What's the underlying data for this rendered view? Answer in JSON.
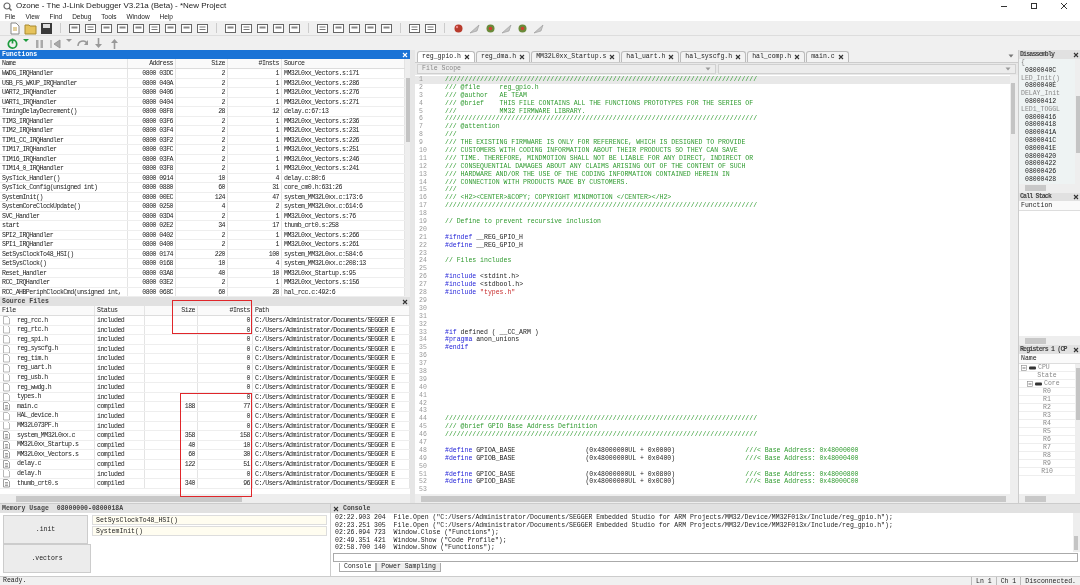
{
  "window": {
    "title": "Ozone - The J-Link Debugger V3.21a (Beta) - *New Project"
  },
  "menu": [
    "File",
    "View",
    "Find",
    "Debug",
    "Tools",
    "Window",
    "Help"
  ],
  "functions": {
    "title": "Functions",
    "columns": [
      "Name",
      "Address",
      "Size",
      "#Insts",
      "Source"
    ],
    "rows": [
      [
        "WWDG_IRQHandler",
        "0800 03DC",
        "2",
        "1",
        "MM32L0xx_Vectors.s:171"
      ],
      [
        "USB_FS_WKUP_IRQHandler",
        "0800 040A",
        "2",
        "1",
        "MM32L0xx_Vectors.s:286"
      ],
      [
        "UART2_IRQHandler",
        "0800 0406",
        "2",
        "1",
        "MM32L0xx_Vectors.s:276"
      ],
      [
        "UART1_IRQHandler",
        "0800 0404",
        "2",
        "1",
        "MM32L0xx_Vectors.s:271"
      ],
      [
        "TimingDelayDecrement()",
        "0800 08F8",
        "28",
        "12",
        "delay.c:67:13"
      ],
      [
        "TIM3_IRQHandler",
        "0800 03F6",
        "2",
        "1",
        "MM32L0xx_Vectors.s:236"
      ],
      [
        "TIM2_IRQHandler",
        "0800 03F4",
        "2",
        "1",
        "MM32L0xx_Vectors.s:231"
      ],
      [
        "TIM1_CC_IRQHandler",
        "0800 03F2",
        "2",
        "1",
        "MM32L0xx_Vectors.s:226"
      ],
      [
        "TIM17_IRQHandler",
        "0800 03FC",
        "2",
        "1",
        "MM32L0xx_Vectors.s:251"
      ],
      [
        "TIM16_IRQHandler",
        "0800 03FA",
        "2",
        "1",
        "MM32L0xx_Vectors.s:246"
      ],
      [
        "TIM14_0_IRQHandler",
        "0800 03F8",
        "2",
        "1",
        "MM32L0xx_Vectors.s:241"
      ],
      [
        "SysTick_Handler()",
        "0800 0914",
        "10",
        "4",
        "delay.c:80:6"
      ],
      [
        "SysTick_Config(unsigned int)",
        "0800 0880",
        "60",
        "31",
        "core_cm0.h:631:26"
      ],
      [
        "SystemInit()",
        "0800 00EC",
        "124",
        "47",
        "system_MM32L0xx.c:173:6"
      ],
      [
        "SystemCoreClockUpdate()",
        "0800 0250",
        "4",
        "2",
        "system_MM32L0xx.c:614:6"
      ],
      [
        "SVC_Handler",
        "0800 03D4",
        "2",
        "1",
        "MM32L0xx_Vectors.s:76"
      ],
      [
        "start",
        "0800 02E2",
        "34",
        "17",
        "thumb_crt0.s:258"
      ],
      [
        "SPI2_IRQHandler",
        "0800 0402",
        "2",
        "1",
        "MM32L0xx_Vectors.s:266"
      ],
      [
        "SPI1_IRQHandler",
        "0800 0400",
        "2",
        "1",
        "MM32L0xx_Vectors.s:261"
      ],
      [
        "SetSysClockTo48_HSI()",
        "0800 0174",
        "220",
        "100",
        "system_MM32L0xx.c:584:6"
      ],
      [
        "SetSysClock()",
        "0800 0168",
        "10",
        "4",
        "system_MM32L0xx.c:208:13"
      ],
      [
        "Reset_Handler",
        "0800 03A8",
        "40",
        "10",
        "MM32L0xx_Startup.s:95"
      ],
      [
        "RCC_IRQHandler",
        "0800 03E2",
        "2",
        "1",
        "MM32L0xx_Vectors.s:156"
      ],
      [
        "RCC_AHBPeriphClockCmd(unsigned int,",
        "0800 068C",
        "60",
        "28",
        "hal_rcc.c:492:6"
      ]
    ]
  },
  "source_files": {
    "title": "Source Files",
    "columns": [
      "File",
      "Status",
      "Size",
      "#Insts",
      "Path"
    ],
    "rows": [
      {
        "kind": "header",
        "file": "reg_rcc.h",
        "status": "included",
        "insts": "0",
        "path": "C:/Users/Administrator/Documents/SEGGER E"
      },
      {
        "kind": "header",
        "file": "reg_rtc.h",
        "status": "included",
        "insts": "0",
        "path": "C:/Users/Administrator/Documents/SEGGER E"
      },
      {
        "kind": "header",
        "file": "reg_spi.h",
        "status": "included",
        "insts": "0",
        "path": "C:/Users/Administrator/Documents/SEGGER E"
      },
      {
        "kind": "header",
        "file": "reg_syscfg.h",
        "status": "included",
        "insts": "0",
        "path": "C:/Users/Administrator/Documents/SEGGER E"
      },
      {
        "kind": "header",
        "file": "reg_tim.h",
        "status": "included",
        "insts": "0",
        "path": "C:/Users/Administrator/Documents/SEGGER E"
      },
      {
        "kind": "header",
        "file": "reg_uart.h",
        "status": "included",
        "insts": "0",
        "path": "C:/Users/Administrator/Documents/SEGGER E"
      },
      {
        "kind": "header",
        "file": "reg_usb.h",
        "status": "included",
        "insts": "0",
        "path": "C:/Users/Administrator/Documents/SEGGER E"
      },
      {
        "kind": "header",
        "file": "reg_wwdg.h",
        "status": "included",
        "insts": "0",
        "path": "C:/Users/Administrator/Documents/SEGGER E"
      },
      {
        "kind": "header",
        "file": "types.h",
        "status": "included",
        "insts": "0",
        "path": "C:/Users/Administrator/Documents/SEGGER E"
      },
      {
        "kind": "compiled",
        "file": "main.c",
        "status": "compiled",
        "size": "188",
        "insts": "77",
        "path": "C:/Users/Administrator/Documents/SEGGER E"
      },
      {
        "kind": "header",
        "file": "HAL_device.h",
        "status": "included",
        "insts": "0",
        "path": "C:/Users/Administrator/Documents/SEGGER E"
      },
      {
        "kind": "header",
        "file": "MM32L073PF.h",
        "status": "included",
        "insts": "0",
        "path": "C:/Users/Administrator/Documents/SEGGER E"
      },
      {
        "kind": "compiled",
        "file": "system_MM32L0xx.c",
        "status": "compiled",
        "size": "358",
        "insts": "158",
        "path": "C:/Users/Administrator/Documents/SEGGER E"
      },
      {
        "kind": "compiled",
        "file": "MM32L0xx_Startup.s",
        "status": "compiled",
        "size": "40",
        "insts": "10",
        "path": "C:/Users/Administrator/Documents/SEGGER E"
      },
      {
        "kind": "compiled",
        "file": "MM32L0xx_Vectors.s",
        "status": "compiled",
        "size": "60",
        "insts": "30",
        "path": "C:/Users/Administrator/Documents/SEGGER E"
      },
      {
        "kind": "compiled",
        "file": "delay.c",
        "status": "compiled",
        "size": "122",
        "insts": "51",
        "path": "C:/Users/Administrator/Documents/SEGGER E"
      },
      {
        "kind": "header",
        "file": "delay.h",
        "status": "included",
        "insts": "0",
        "path": "C:/Users/Administrator/Documents/SEGGER E"
      },
      {
        "kind": "compiled",
        "file": "thumb_crt0.s",
        "status": "compiled",
        "size": "340",
        "insts": "96",
        "path": "C:/Users/Administrator/Documents/SEGGER E"
      }
    ]
  },
  "editor": {
    "tabs": [
      {
        "label": "reg_gpio.h",
        "selected": true
      },
      {
        "label": "reg_dma.h",
        "selected": false
      },
      {
        "label": "MM32L0xx_Startup.s",
        "selected": false
      },
      {
        "label": "hal_uart.h",
        "selected": false
      },
      {
        "label": "hal_syscfg.h",
        "selected": false
      },
      {
        "label": "hal_comp.h",
        "selected": false
      },
      {
        "label": "main.c",
        "selected": false
      }
    ],
    "scope": "File Scope",
    "lines": [
      {
        "n": "1",
        "selected": true,
        "tokens": [
          {
            "kind": "comment",
            "text": "////////////////////////////////////////////////////////////////////////////////"
          }
        ]
      },
      {
        "n": "2",
        "selected": false,
        "tokens": [
          {
            "kind": "comment",
            "text": "/// @file     reg_gpio.h"
          }
        ]
      },
      {
        "n": "3",
        "selected": false,
        "tokens": [
          {
            "kind": "comment",
            "text": "/// @author   AE TEAM"
          }
        ]
      },
      {
        "n": "4",
        "selected": false,
        "tokens": [
          {
            "kind": "comment",
            "text": "/// @brief    THIS FILE CONTAINS ALL THE FUNCTIONS PROTOTYPES FOR THE SERIES OF"
          }
        ]
      },
      {
        "n": "5",
        "selected": false,
        "tokens": [
          {
            "kind": "comment",
            "text": "///           MM32 FIRMWARE LIBRARY."
          }
        ]
      },
      {
        "n": "6",
        "selected": false,
        "tokens": [
          {
            "kind": "comment",
            "text": "////////////////////////////////////////////////////////////////////////////////"
          }
        ]
      },
      {
        "n": "7",
        "selected": false,
        "tokens": [
          {
            "kind": "comment",
            "text": "/// @attention"
          }
        ]
      },
      {
        "n": "8",
        "selected": false,
        "tokens": [
          {
            "kind": "comment",
            "text": "///"
          }
        ]
      },
      {
        "n": "9",
        "selected": false,
        "tokens": [
          {
            "kind": "comment",
            "text": "/// THE EXISTING FIRMWARE IS ONLY FOR REFERENCE, WHICH IS DESIGNED TO PROVIDE"
          }
        ]
      },
      {
        "n": "10",
        "selected": false,
        "tokens": [
          {
            "kind": "comment",
            "text": "/// CUSTOMERS WITH CODING INFORMATION ABOUT THEIR PRODUCTS SO THEY CAN SAVE"
          }
        ]
      },
      {
        "n": "11",
        "selected": false,
        "tokens": [
          {
            "kind": "comment",
            "text": "/// TIME. THEREFORE, MINDMOTION SHALL NOT BE LIABLE FOR ANY DIRECT, INDIRECT OR"
          }
        ]
      },
      {
        "n": "12",
        "selected": false,
        "tokens": [
          {
            "kind": "comment",
            "text": "/// CONSEQUENTIAL DAMAGES ABOUT ANY CLAIMS ARISING OUT OF THE CONTENT OF SUCH"
          }
        ]
      },
      {
        "n": "13",
        "selected": false,
        "tokens": [
          {
            "kind": "comment",
            "text": "/// HARDWARE AND/OR THE USE OF THE CODING INFORMATION CONTAINED HEREIN IN"
          }
        ]
      },
      {
        "n": "14",
        "selected": false,
        "tokens": [
          {
            "kind": "comment",
            "text": "/// CONNECTION WITH PRODUCTS MADE BY CUSTOMERS."
          }
        ]
      },
      {
        "n": "15",
        "selected": false,
        "tokens": [
          {
            "kind": "comment",
            "text": "///"
          }
        ]
      },
      {
        "n": "16",
        "selected": false,
        "tokens": [
          {
            "kind": "comment",
            "text": "/// <H2><CENTER>&COPY; COPYRIGHT MINDMOTION </CENTER></H2>"
          }
        ]
      },
      {
        "n": "17",
        "selected": false,
        "tokens": [
          {
            "kind": "comment",
            "text": "////////////////////////////////////////////////////////////////////////////////"
          }
        ]
      },
      {
        "n": "18",
        "selected": false
      },
      {
        "n": "19",
        "selected": false,
        "tokens": [
          {
            "kind": "comment",
            "text": "// Define to prevent recursive inclusion"
          }
        ]
      },
      {
        "n": "20",
        "selected": false
      },
      {
        "n": "21",
        "selected": false,
        "tokens": [
          {
            "kind": "pp",
            "text": "#ifndef"
          },
          {
            "kind": "plain",
            "text": " __REG_GPIO_H"
          }
        ]
      },
      {
        "n": "22",
        "selected": false,
        "tokens": [
          {
            "kind": "pp",
            "text": "#define"
          },
          {
            "kind": "plain",
            "text": " __REG_GPIO_H"
          }
        ]
      },
      {
        "n": "23",
        "selected": false
      },
      {
        "n": "24",
        "selected": false,
        "tokens": [
          {
            "kind": "comment",
            "text": "// Files includes"
          }
        ]
      },
      {
        "n": "25",
        "selected": false
      },
      {
        "n": "26",
        "selected": false,
        "tokens": [
          {
            "kind": "pp",
            "text": "#include"
          },
          {
            "kind": "plain",
            "text": " <stdint.h>"
          }
        ]
      },
      {
        "n": "27",
        "selected": false,
        "tokens": [
          {
            "kind": "pp",
            "text": "#include"
          },
          {
            "kind": "plain",
            "text": " <stdbool.h>"
          }
        ]
      },
      {
        "n": "28",
        "selected": false,
        "tokens": [
          {
            "kind": "pp",
            "text": "#include"
          },
          {
            "kind": "string",
            "text": " \"types.h\""
          }
        ]
      },
      {
        "n": "29",
        "selected": false
      },
      {
        "n": "30",
        "selected": false
      },
      {
        "n": "31",
        "selected": false
      },
      {
        "n": "32",
        "selected": false
      },
      {
        "n": "33",
        "selected": false,
        "tokens": [
          {
            "kind": "pp",
            "text": "#if"
          },
          {
            "kind": "plain",
            "text": " defined ( __CC_ARM )"
          }
        ]
      },
      {
        "n": "34",
        "selected": false,
        "tokens": [
          {
            "kind": "pp",
            "text": "#pragma"
          },
          {
            "kind": "plain",
            "text": " anon_unions"
          }
        ]
      },
      {
        "n": "35",
        "selected": false,
        "tokens": [
          {
            "kind": "pp",
            "text": "#endif"
          }
        ]
      },
      {
        "n": "36",
        "selected": false
      },
      {
        "n": "37",
        "selected": false
      },
      {
        "n": "38",
        "selected": false
      },
      {
        "n": "39",
        "selected": false
      },
      {
        "n": "40",
        "selected": false
      },
      {
        "n": "41",
        "selected": false
      },
      {
        "n": "42",
        "selected": false
      },
      {
        "n": "43",
        "selected": false
      },
      {
        "n": "44",
        "selected": false,
        "tokens": [
          {
            "kind": "comment",
            "text": "////////////////////////////////////////////////////////////////////////////////"
          }
        ]
      },
      {
        "n": "45",
        "selected": false,
        "tokens": [
          {
            "kind": "comment",
            "text": "/// @brief GPIO Base Address Definition"
          }
        ]
      },
      {
        "n": "46",
        "selected": false,
        "tokens": [
          {
            "kind": "comment",
            "text": "////////////////////////////////////////////////////////////////////////////////"
          }
        ]
      },
      {
        "n": "47",
        "selected": false
      },
      {
        "n": "48",
        "selected": false,
        "tokens": [
          {
            "kind": "pp",
            "text": "#define"
          },
          {
            "kind": "plain",
            "text": " GPIOA_BASE                  (0x48000000UL + 0x0000)                  "
          },
          {
            "kind": "comment",
            "text": "///< Base Address: 0x48000000"
          }
        ]
      },
      {
        "n": "49",
        "selected": false,
        "tokens": [
          {
            "kind": "pp",
            "text": "#define"
          },
          {
            "kind": "plain",
            "text": " GPIOB_BASE                  (0x48000000UL + 0x0400)                  "
          },
          {
            "kind": "comment",
            "text": "///< Base Address: 0x48000400"
          }
        ]
      },
      {
        "n": "50",
        "selected": false
      },
      {
        "n": "51",
        "selected": false,
        "tokens": [
          {
            "kind": "pp",
            "text": "#define"
          },
          {
            "kind": "plain",
            "text": " GPIOC_BASE                  (0x48000000UL + 0x0800)                  "
          },
          {
            "kind": "comment",
            "text": "///< Base Address: 0x48000800"
          }
        ]
      },
      {
        "n": "52",
        "selected": false,
        "tokens": [
          {
            "kind": "pp",
            "text": "#define"
          },
          {
            "kind": "plain",
            "text": " GPIOD_BASE                  (0x48000000UL + 0x0C00)                  "
          },
          {
            "kind": "comment",
            "text": "///< Base Address: 0x48000C00"
          }
        ]
      },
      {
        "n": "53",
        "selected": false
      }
    ]
  },
  "disassembly": {
    "title": "Disassembly",
    "rows": [
      {
        "kind": "source",
        "text": "{"
      },
      {
        "kind": "address",
        "text": "0800040C"
      },
      {
        "kind": "source",
        "text": "LED_Init()"
      },
      {
        "kind": "address",
        "text": "0800040E"
      },
      {
        "kind": "source",
        "text": "DELAY_Init"
      },
      {
        "kind": "address",
        "text": "08000412"
      },
      {
        "kind": "source",
        "text": "LED1_TOGGL"
      },
      {
        "kind": "address",
        "text": "08000416"
      },
      {
        "kind": "address",
        "text": "08000418"
      },
      {
        "kind": "address",
        "text": "0800041A"
      },
      {
        "kind": "address",
        "text": "0800041C"
      },
      {
        "kind": "address",
        "text": "0800041E"
      },
      {
        "kind": "address",
        "text": "08000420"
      },
      {
        "kind": "address",
        "text": "08000422"
      },
      {
        "kind": "address",
        "text": "08000426"
      },
      {
        "kind": "address",
        "text": "08000428"
      }
    ]
  },
  "call_stack": {
    "title": "Call Stack",
    "columns": [
      "Function"
    ]
  },
  "registers": {
    "title": "Registers 1 (CP",
    "columns": [
      "Name"
    ],
    "tree": [
      {
        "label": "CPU",
        "expanded": true,
        "children": [
          {
            "label": "State"
          },
          {
            "label": "Core",
            "expanded": true,
            "children": [
              {
                "label": "R0"
              },
              {
                "label": "R1"
              },
              {
                "label": "R2"
              },
              {
                "label": "R3"
              },
              {
                "label": "R4"
              },
              {
                "label": "R5"
              },
              {
                "label": "R6"
              },
              {
                "label": "R7"
              },
              {
                "label": "R8"
              },
              {
                "label": "R9"
              },
              {
                "label": "R10"
              }
            ]
          }
        ]
      }
    ]
  },
  "memory_usage": {
    "title": "Memory Usage",
    "range": "08000000-0800018A",
    "sections": [
      {
        "label": ".init",
        "entries": [
          "SetSysClockTo48_HSI()",
          "SystemInit()"
        ]
      },
      {
        "label": ".vectors"
      }
    ]
  },
  "console": {
    "title": "Console",
    "lines": [
      "02:22.903 204  File.Open (\"C:/Users/Administrator/Documents/SEGGER Embedded Studio for ARM Projects/MM32/Device/MM32F013x/Include/reg_gpio.h\");",
      "02:23.251 305  File.Open (\"C:/Users/Administrator/Documents/SEGGER Embedded Studio for ARM Projects/MM32/Device/MM32F013x/Include/reg_gpio.h\");",
      "02:26.094 723  Window.Close (\"Functions\");",
      "02:49.351 421  Window.Show (\"Code Profile\");",
      "02:58.700 140  Window.Show (\"Functions\");"
    ],
    "tabs": [
      {
        "label": "Console",
        "selected": true
      },
      {
        "label": "Power Sampling",
        "selected": false
      }
    ]
  },
  "status_bar": {
    "message": "Ready.",
    "line": "Ln 1",
    "column": "Ch 1",
    "connection": "Disconnected."
  }
}
